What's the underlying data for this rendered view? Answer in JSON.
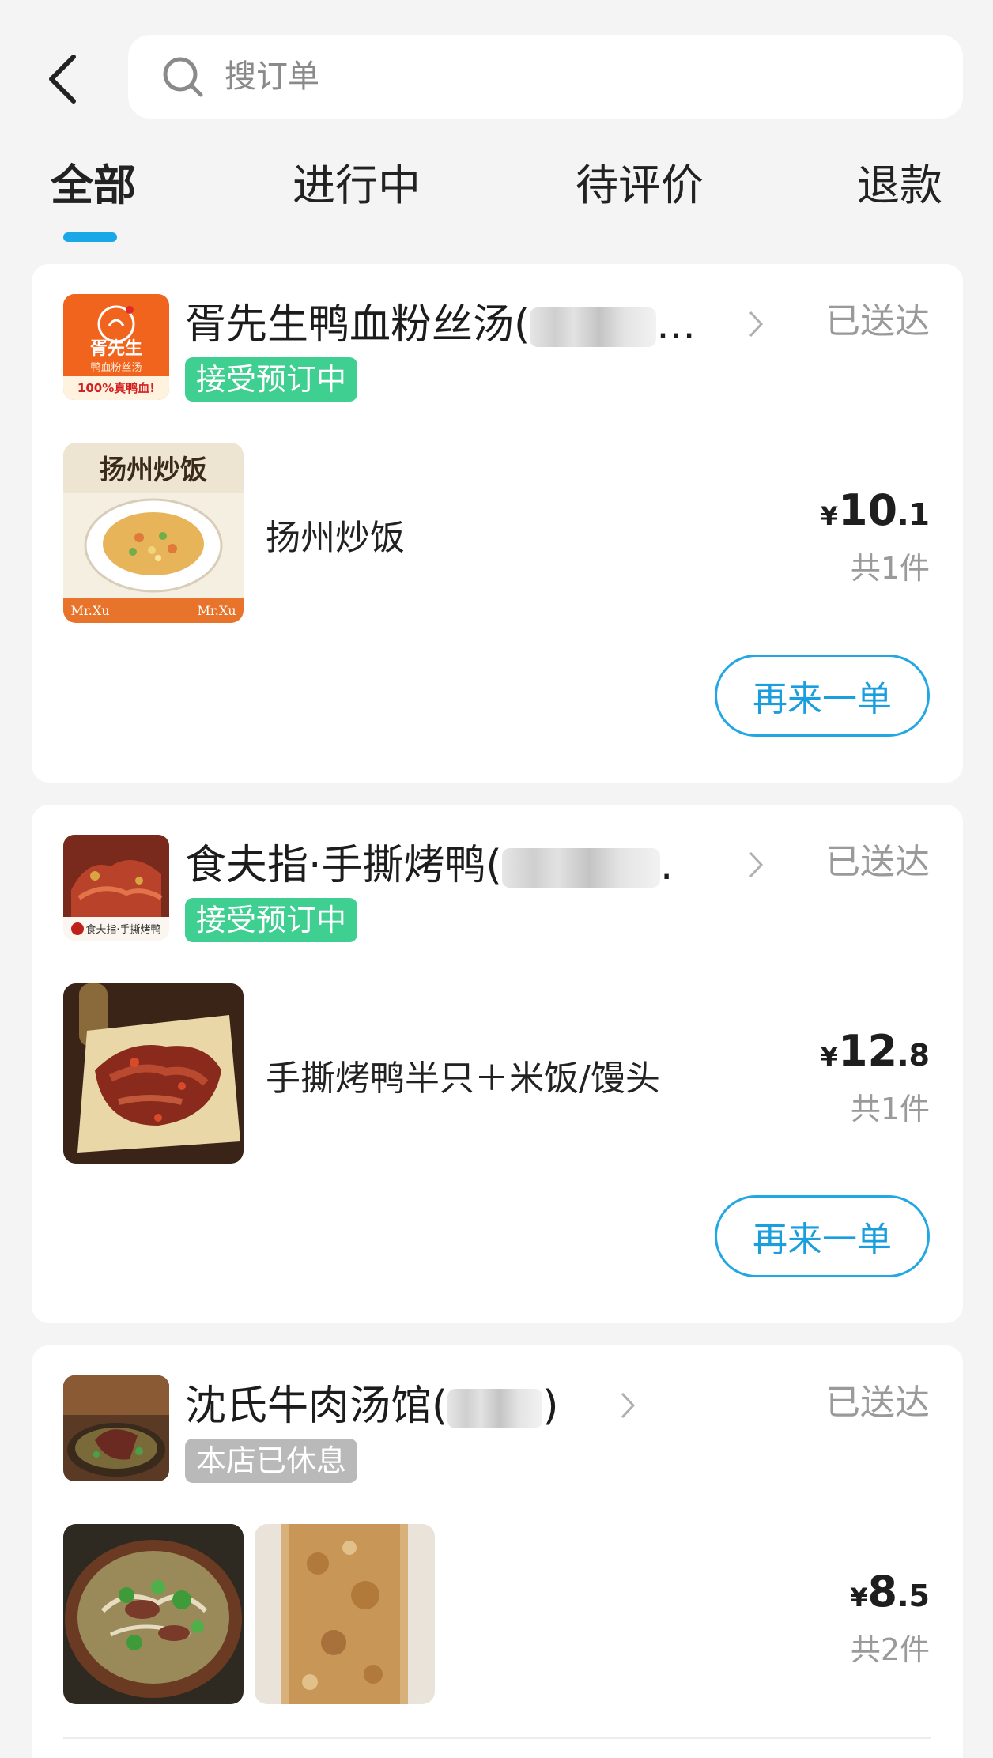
{
  "search": {
    "placeholder": "搜订单"
  },
  "tabs": [
    {
      "label": "全部"
    },
    {
      "label": "进行中"
    },
    {
      "label": "待评价"
    },
    {
      "label": "退款"
    }
  ],
  "orders": [
    {
      "shop_name": "胥先生鸭血粉丝汤(",
      "shop_name_tail": "...",
      "status": "已送达",
      "badge": "接受预订中",
      "logo_text": "胥先生",
      "logo_sub": "鸭血粉丝汤",
      "logo_foot": "100%真鸭血!",
      "item_img_title": "扬州炒饭",
      "item_img_brand": "Mr.Xu",
      "item_name": "扬州炒饭",
      "price_currency": "¥",
      "price_int": "10",
      "price_dec": ".1",
      "count": "共1件",
      "reorder_label": "再来一单"
    },
    {
      "shop_name": "食夫指·手撕烤鸭(",
      "shop_name_tail": ".",
      "status": "已送达",
      "badge": "接受预订中",
      "logo_foot": "食夫指·手撕烤鸭",
      "item_name": "手撕烤鸭半只＋米饭/馒头",
      "price_currency": "¥",
      "price_int": "12",
      "price_dec": ".8",
      "count": "共1件",
      "reorder_label": "再来一单"
    },
    {
      "shop_name": "沈氏牛肉汤馆(",
      "shop_name_tail": ")",
      "status": "已送达",
      "badge": "本店已休息",
      "price_currency": "¥",
      "price_int": "8",
      "price_dec": ".5",
      "count": "共2件"
    }
  ],
  "colors": {
    "accent": "#1aa7e8",
    "badge_open": "#3ecf91",
    "badge_closed": "#b9b9b9",
    "muted_text": "#9a9a9a"
  }
}
